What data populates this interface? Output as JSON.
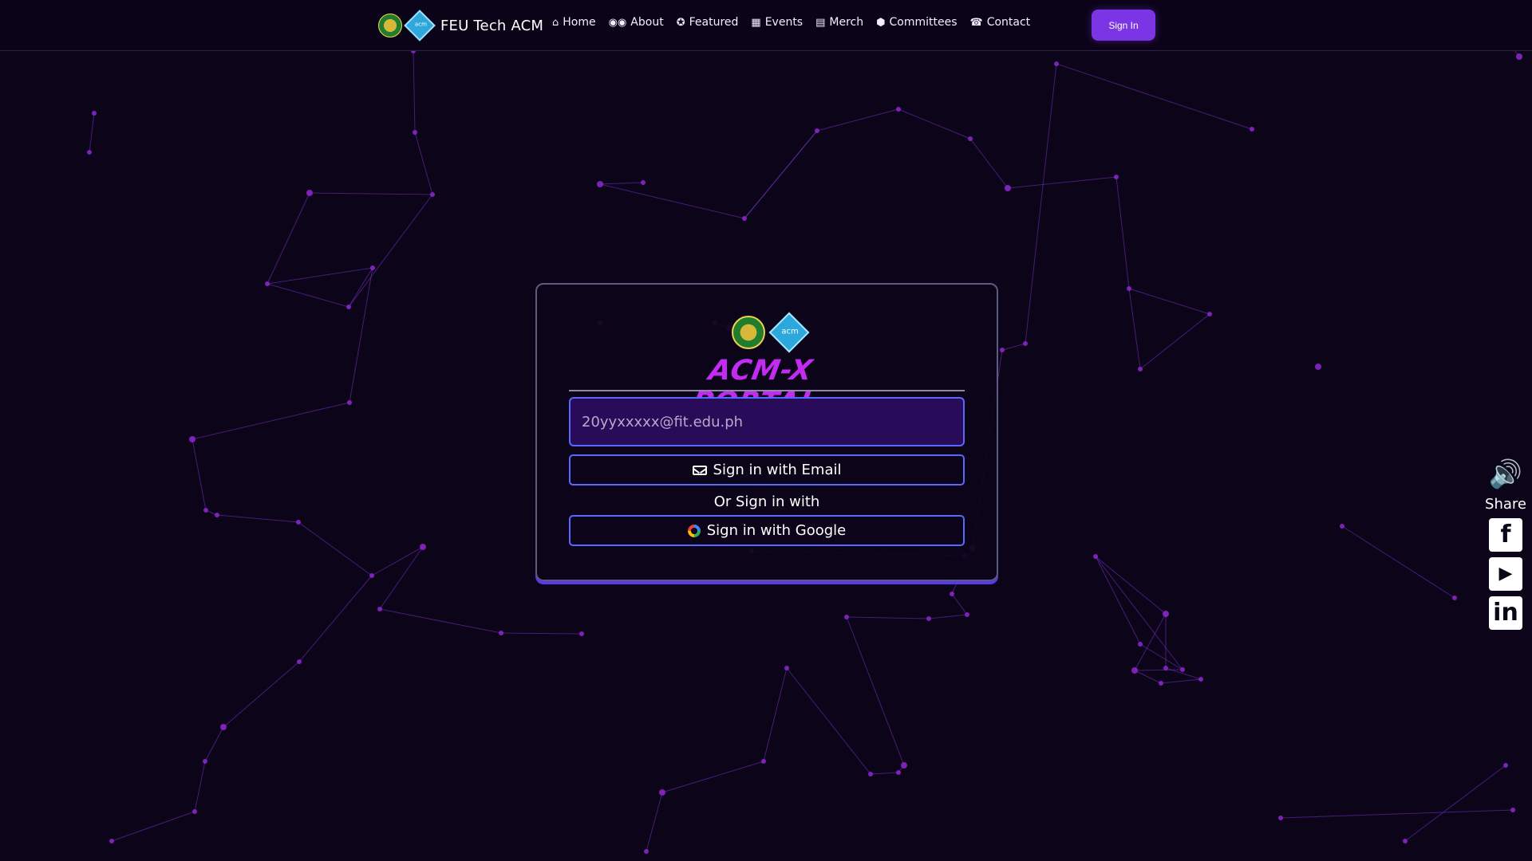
{
  "header": {
    "brand_text": "FEU Tech ACM",
    "logo_acm_text": "acm",
    "nav": [
      {
        "label": "Home",
        "icon": "home-icon",
        "glyph": "⌂"
      },
      {
        "label": "About",
        "icon": "binoculars-icon",
        "glyph": "◉◉"
      },
      {
        "label": "Featured",
        "icon": "award-icon",
        "glyph": "✪"
      },
      {
        "label": "Events",
        "icon": "calendar-icon",
        "glyph": "▦"
      },
      {
        "label": "Merch",
        "icon": "store-icon",
        "glyph": "▤"
      },
      {
        "label": "Committees",
        "icon": "gear-icon",
        "glyph": "⬢"
      },
      {
        "label": "Contact",
        "icon": "phone-icon",
        "glyph": "☎"
      }
    ],
    "sign_in_label": "Sign In"
  },
  "portal": {
    "logo_acm_text": "acm",
    "title": "ACM-X PORTAL",
    "email_placeholder": "20yyxxxxx@fit.edu.ph",
    "email_button": "Sign in with Email",
    "or_text": "Or Sign in with",
    "google_button": "Sign in with Google"
  },
  "side_panel": {
    "speaker_icon": "speaker-icon",
    "share_label": "Share",
    "social": [
      {
        "name": "facebook-icon",
        "glyph": "f"
      },
      {
        "name": "youtube-icon",
        "glyph": "▶"
      },
      {
        "name": "linkedin-icon",
        "glyph": "in"
      }
    ]
  },
  "colors": {
    "background": "#0c0419",
    "accent": "#7b35e4",
    "title": "#c22cf2",
    "input_border": "#5c67ff",
    "network": "#8f27d2"
  }
}
